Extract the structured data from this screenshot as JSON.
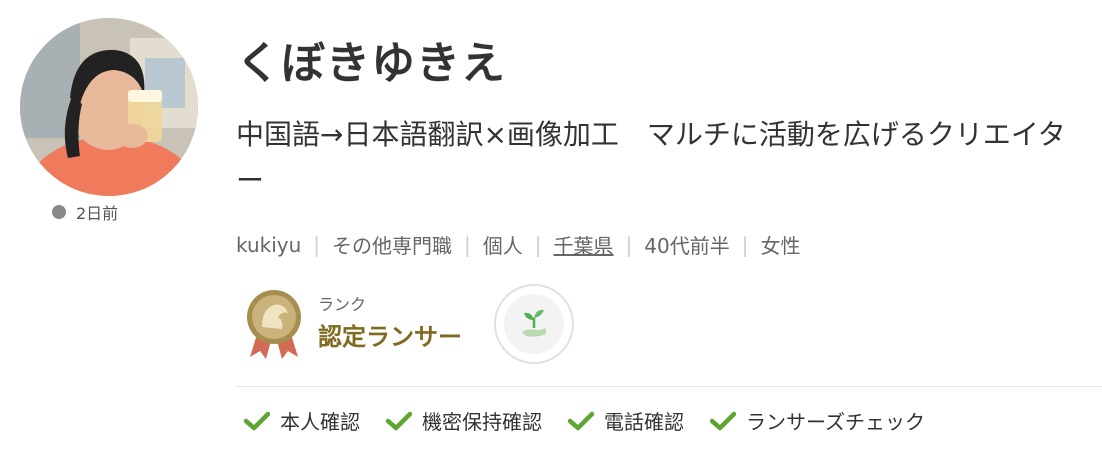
{
  "profile": {
    "name": "くぼきゆきえ",
    "catchphrase": "中国語→日本語翻訳×画像加工　マルチに活動を広げるクリエイター",
    "last_login": "2日前",
    "meta": {
      "username": "kukiyu",
      "occupation": "その他専門職",
      "type": "個人",
      "location": "千葉県",
      "age": "40代前半",
      "gender": "女性"
    }
  },
  "rank": {
    "label": "ランク",
    "value": "認定ランサー"
  },
  "verifications": [
    {
      "label": "本人確認"
    },
    {
      "label": "機密保持確認"
    },
    {
      "label": "電話確認"
    },
    {
      "label": "ランサーズチェック"
    }
  ],
  "colors": {
    "check_green": "#5ea632",
    "rank_gold": "#7f6a1f",
    "medal_ribbon": "#d36a55",
    "sprout_green": "#4caf50"
  }
}
